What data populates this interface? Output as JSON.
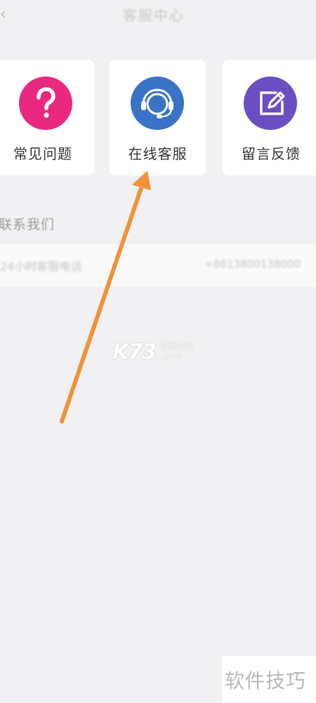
{
  "header": {
    "title": "客服中心",
    "back_icon": "chevron-left-icon"
  },
  "services": [
    {
      "label": "常见问题",
      "icon": "question-mark-icon",
      "color": "#e8297f"
    },
    {
      "label": "在线客服",
      "icon": "headset-agent-icon",
      "color": "#3a73c6"
    },
    {
      "label": "留言反馈",
      "icon": "edit-note-icon",
      "color": "#6a4fc2"
    }
  ],
  "contact": {
    "section_title": "联系我们",
    "row_label": "24小时客服电话",
    "row_value": "+8613800138000"
  },
  "watermark": {
    "logo": "K73",
    "cn": "游戏之家",
    "com": ".com"
  },
  "annotation": {
    "arrow_color": "#f0923a"
  },
  "brand": {
    "text": "软件技巧"
  }
}
